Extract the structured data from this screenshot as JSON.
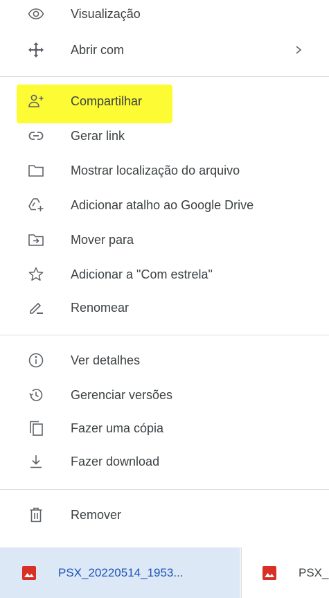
{
  "menu": {
    "items": [
      {
        "id": "visualizacao",
        "label": "Visualização",
        "icon": "eye-icon"
      },
      {
        "id": "abrir-com",
        "label": "Abrir com",
        "icon": "move-arrows-icon",
        "submenu_indicator": "›"
      },
      {
        "id": "compartilhar",
        "label": "Compartilhar",
        "icon": "person-add-icon",
        "highlighted": true
      },
      {
        "id": "gerar-link",
        "label": "Gerar link",
        "icon": "link-icon"
      },
      {
        "id": "mostrar-localizacao",
        "label": "Mostrar localização do arquivo",
        "icon": "folder-icon"
      },
      {
        "id": "adicionar-atalho",
        "label": "Adicionar atalho ao Google Drive",
        "icon": "drive-shortcut-add-icon"
      },
      {
        "id": "mover-para",
        "label": "Mover para",
        "icon": "folder-move-icon"
      },
      {
        "id": "com-estrela",
        "label": "Adicionar a \"Com estrela\"",
        "icon": "star-outline-icon"
      },
      {
        "id": "renomear",
        "label": "Renomear",
        "icon": "pencil-icon"
      },
      {
        "id": "ver-detalhes",
        "label": "Ver detalhes",
        "icon": "info-icon"
      },
      {
        "id": "gerenciar-versoes",
        "label": "Gerenciar versões",
        "icon": "history-icon"
      },
      {
        "id": "fazer-copia",
        "label": "Fazer uma cópia",
        "icon": "copy-icon"
      },
      {
        "id": "fazer-download",
        "label": "Fazer download",
        "icon": "download-icon"
      },
      {
        "id": "remover",
        "label": "Remover",
        "icon": "trash-icon"
      }
    ]
  },
  "colors": {
    "highlight": "#fdfb34",
    "icon": "#5f6368",
    "text": "#3c4043",
    "file_icon": "#d93025",
    "active_tab_bg": "#dde8f6",
    "active_tab_text": "#1a54b8"
  },
  "taskbar": {
    "tabs": [
      {
        "name": "PSX_20220514_1953...",
        "icon": "image-file-icon",
        "active": true
      },
      {
        "name": "PSX_",
        "icon": "image-file-icon",
        "active": false
      }
    ]
  }
}
